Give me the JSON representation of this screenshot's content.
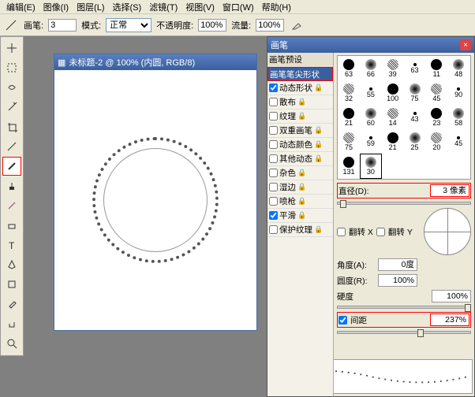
{
  "menu": {
    "items": [
      "编辑(E)",
      "图像(I)",
      "图层(L)",
      "选择(S)",
      "滤镜(T)",
      "视图(V)",
      "窗口(W)",
      "帮助(H)"
    ]
  },
  "options": {
    "brush_label": "画笔:",
    "brush_size": "3",
    "mode_label": "模式:",
    "mode_value": "正常",
    "opacity_label": "不透明度:",
    "opacity_value": "100%",
    "flow_label": "流量:",
    "flow_value": "100%"
  },
  "doc": {
    "title": "未标题-2 @ 100% (内圆, RGB/8)"
  },
  "panel": {
    "title": "画笔",
    "sections": {
      "preset": "画笔预设",
      "tip": "画笔笔尖形状",
      "dynShape": "动态形状",
      "scatter": "散布",
      "texture": "纹理",
      "dual": "双重画笔",
      "dynColor": "动态颜色",
      "otherDyn": "其他动态",
      "noise": "杂色",
      "wet": "湿边",
      "airbrush": "喷枪",
      "smooth": "平滑",
      "protect": "保护纹理"
    },
    "checks": {
      "dynShape": true,
      "scatter": false,
      "texture": false,
      "dual": false,
      "dynColor": false,
      "otherDyn": false,
      "noise": false,
      "wet": false,
      "airbrush": false,
      "smooth": true,
      "protect": false
    },
    "brushes": [
      {
        "v": "63"
      },
      {
        "v": "66"
      },
      {
        "v": "39"
      },
      {
        "v": "63"
      },
      {
        "v": "11"
      },
      {
        "v": "48"
      },
      {
        "v": "32"
      },
      {
        "v": "55"
      },
      {
        "v": "100"
      },
      {
        "v": "75"
      },
      {
        "v": "45"
      },
      {
        "v": "90"
      },
      {
        "v": "21"
      },
      {
        "v": "60"
      },
      {
        "v": "14"
      },
      {
        "v": "43"
      },
      {
        "v": "23"
      },
      {
        "v": "58"
      },
      {
        "v": "75"
      },
      {
        "v": "59"
      },
      {
        "v": "21"
      },
      {
        "v": "25"
      },
      {
        "v": "20"
      },
      {
        "v": "45"
      },
      {
        "v": "131"
      },
      {
        "v": "30",
        "sel": true
      }
    ],
    "params": {
      "diameter_label": "直径(D):",
      "diameter_value": "3 像素",
      "flipx": "翻转 X",
      "flipy": "翻转 Y",
      "angle_label": "角度(A):",
      "angle_value": "0度",
      "round_label": "圆度(R):",
      "round_value": "100%",
      "hard_label": "硬度",
      "hard_value": "100%",
      "spacing_label": "间距",
      "spacing_value": "237%",
      "spacing_checked": true
    }
  }
}
